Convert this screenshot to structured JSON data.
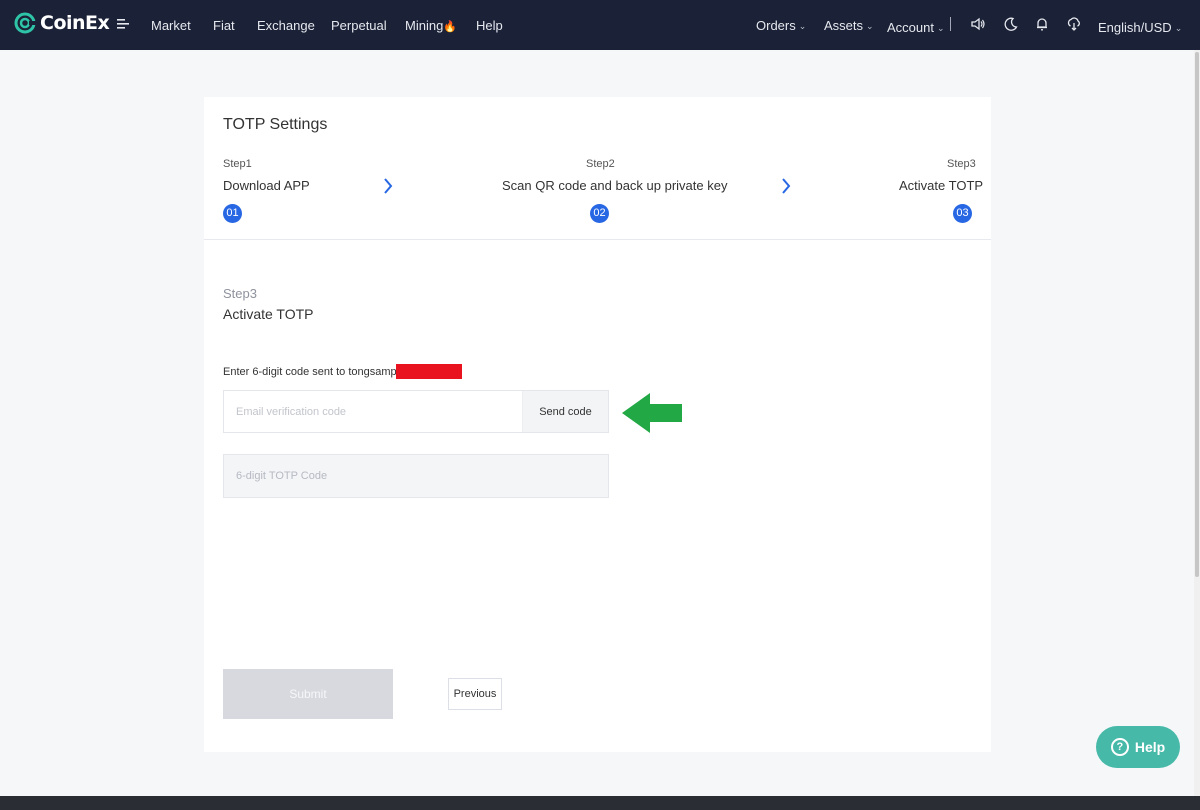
{
  "header": {
    "brand": "CoinEx",
    "nav": [
      "Market",
      "Fiat",
      "Exchange",
      "Perpetual",
      "Mining",
      "Help"
    ],
    "mining_badge": "🔥",
    "right": {
      "orders": "Orders",
      "assets": "Assets",
      "account": "Account",
      "language": "English/USD"
    },
    "icons": [
      "menu-icon",
      "speaker-icon",
      "moon-icon",
      "bell-icon",
      "download-icon"
    ]
  },
  "card": {
    "title": "TOTP Settings",
    "steps": [
      {
        "small": "Step1",
        "label": "Download APP",
        "num": "01"
      },
      {
        "small": "Step2",
        "label": "Scan QR code and back up private key",
        "num": "02"
      },
      {
        "small": "Step3",
        "label": "Activate TOTP",
        "num": "03"
      }
    ]
  },
  "form": {
    "step": "Step3",
    "title": "Activate TOTP",
    "enter_label": "Enter 6-digit code sent to tongsampahx",
    "email_placeholder": "Email verification code",
    "send_code": "Send code",
    "totp_placeholder": "6-digit TOTP Code",
    "submit": "Submit",
    "previous": "Previous"
  },
  "help_fab": {
    "label": "Help",
    "icon_glyph": "?"
  },
  "colors": {
    "topbar": "#1b2136",
    "accent": "#2767e3",
    "arrow": "#22a845",
    "redaction": "#e8131f",
    "help": "#46b9a8"
  }
}
